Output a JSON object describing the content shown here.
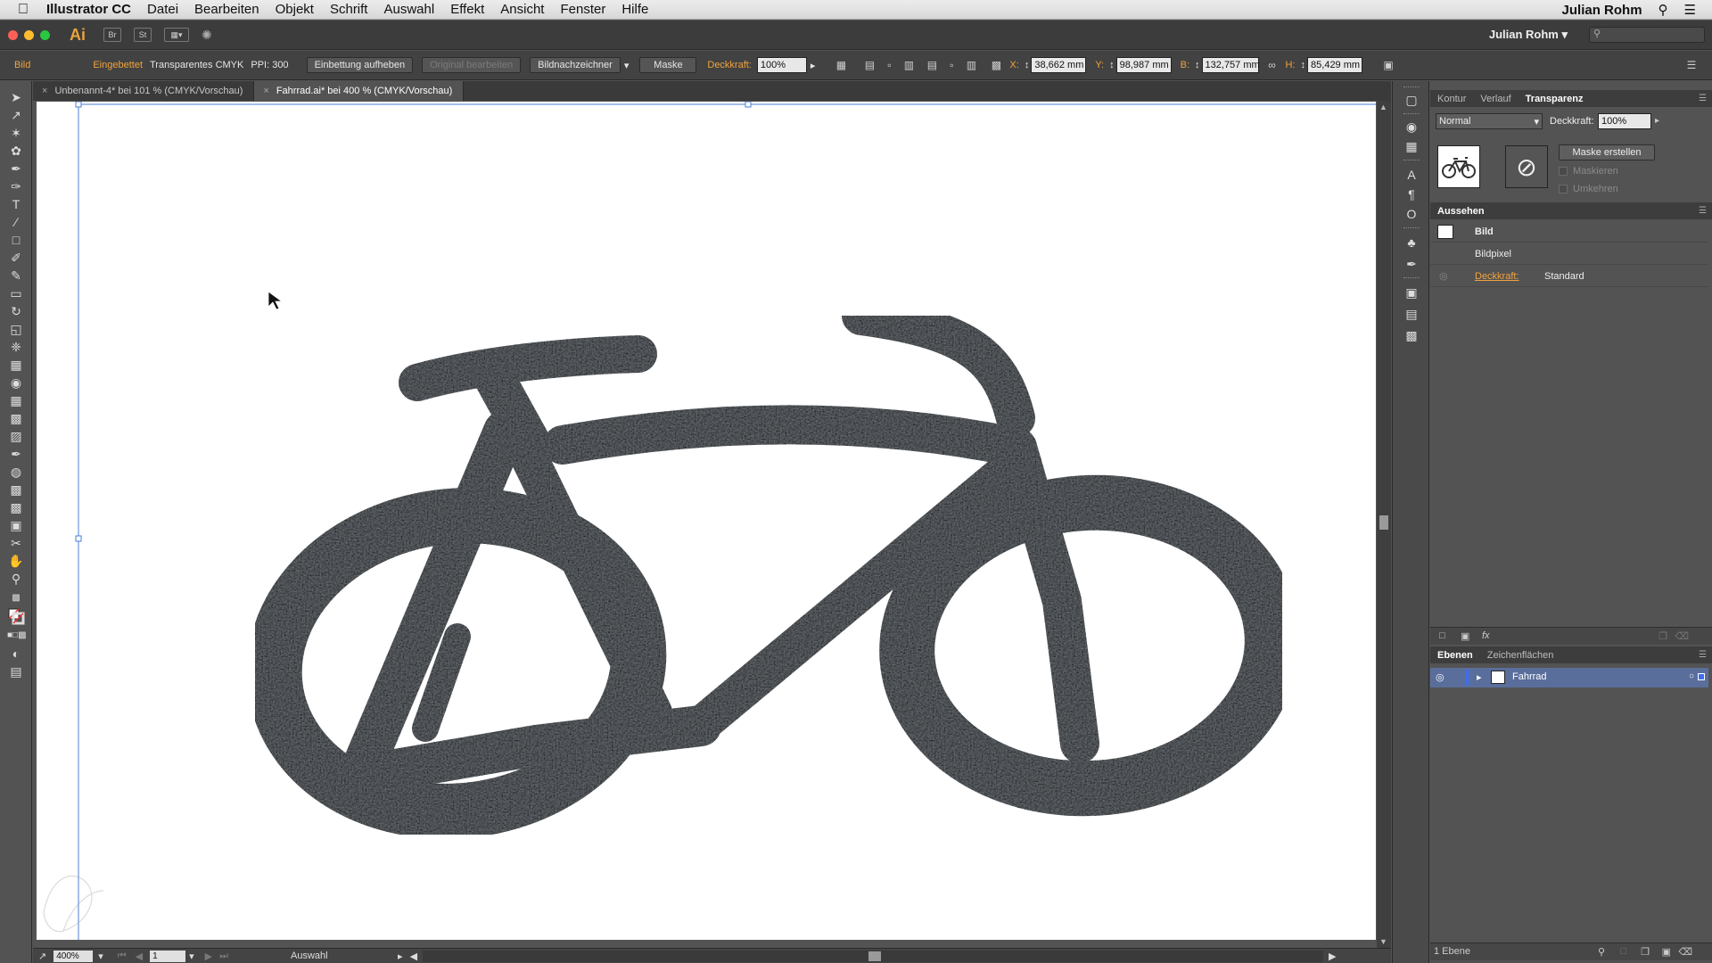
{
  "menubar": {
    "app_name": "Illustrator CC",
    "items": [
      "Datei",
      "Bearbeiten",
      "Objekt",
      "Schrift",
      "Auswahl",
      "Effekt",
      "Ansicht",
      "Fenster",
      "Hilfe"
    ],
    "user": "Julian Rohm"
  },
  "appbar": {
    "logo": "Ai",
    "bridge": "Br",
    "stock": "St",
    "workspace": "Julian Rohm"
  },
  "controlbar": {
    "selection_type": "Bild",
    "embedded": "Eingebettet",
    "colormode": "Transparentes CMYK",
    "ppi": "PPI: 300",
    "unembed": "Einbettung aufheben",
    "edit_original": "Original bearbeiten",
    "image_trace": "Bildnachzeichner",
    "mask": "Maske",
    "opacity_label": "Deckkraft:",
    "opacity_value": "100%",
    "x_label": "X:",
    "x_value": "38,662 mm",
    "y_label": "Y:",
    "y_value": "98,987 mm",
    "w_label": "B:",
    "w_value": "132,757 mm",
    "h_label": "H:",
    "h_value": "85,429 mm"
  },
  "tabs": [
    {
      "label": "Unbenannt-4* bei 101 % (CMYK/Vorschau)",
      "active": false
    },
    {
      "label": "Fahrrad.ai* bei 400 % (CMYK/Vorschau)",
      "active": true
    }
  ],
  "statusbar": {
    "zoom": "400%",
    "page": "1",
    "mode": "Auswahl"
  },
  "transparency_panel": {
    "tabs": [
      "Kontur",
      "Verlauf",
      "Transparenz"
    ],
    "blend_mode": "Normal",
    "opacity_label": "Deckkraft:",
    "opacity_value": "100%",
    "make_mask": "Maske erstellen",
    "clip": "Maskieren",
    "invert": "Umkehren"
  },
  "appearance_panel": {
    "title": "Aussehen",
    "object": "Bild",
    "subitem": "Bildpixel",
    "opacity_label": "Deckkraft:",
    "opacity_value": "Standard",
    "fx": "fx"
  },
  "layers_panel": {
    "tabs": [
      "Ebenen",
      "Zeichenflächen"
    ],
    "layer_name": "Fahrrad",
    "footer_count": "1 Ebene"
  },
  "colors": {
    "accent_orange": "#f0a33d",
    "layer_highlight": "#5a6e9c",
    "bike_fill": "#3a3d40"
  }
}
